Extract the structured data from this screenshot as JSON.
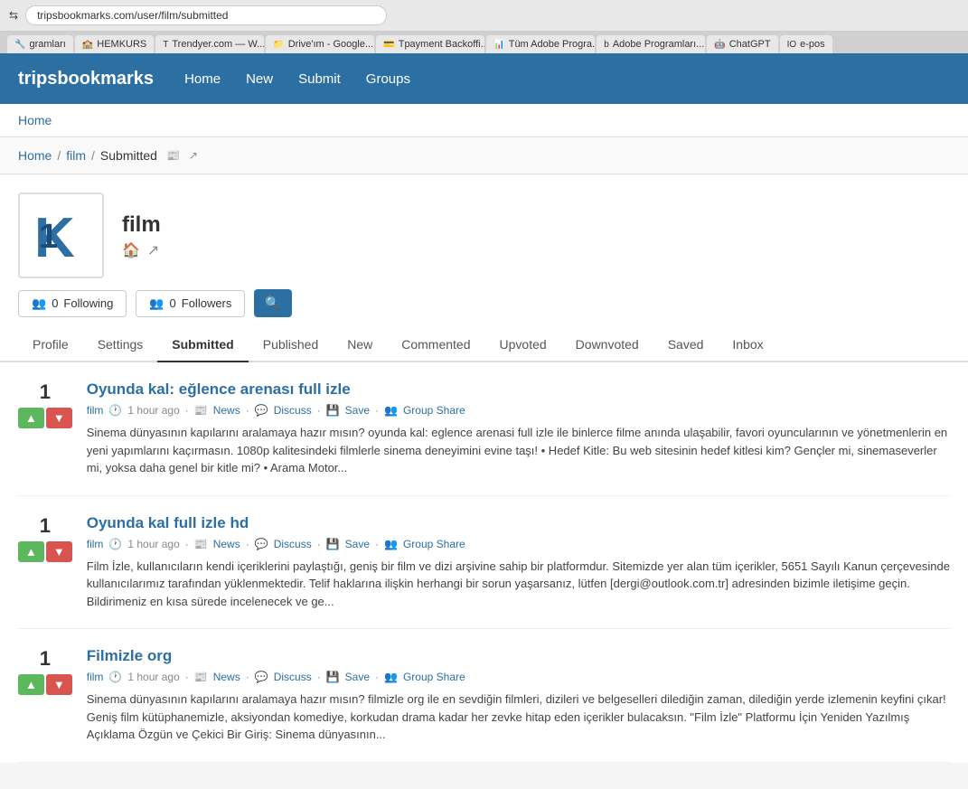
{
  "browser": {
    "url": "tripsbookmarks.com/user/film/submitted",
    "tabs": [
      {
        "label": "gramları",
        "favicon": "🔧",
        "active": false
      },
      {
        "label": "HEMKURS",
        "favicon": "🏫",
        "active": false
      },
      {
        "label": "Trendyer.com — W...",
        "favicon": "T",
        "active": false
      },
      {
        "label": "Drive'ım - Google...",
        "favicon": "📁",
        "active": false
      },
      {
        "label": "Tpayment Backoffi...",
        "favicon": "💳",
        "active": false
      },
      {
        "label": "Tüm Adobe Progra...",
        "favicon": "📊",
        "active": false
      },
      {
        "label": "Adobe Programları...",
        "favicon": "b",
        "active": false
      },
      {
        "label": "ChatGPT",
        "favicon": "🤖",
        "active": false
      },
      {
        "label": "e-pos",
        "favicon": "IO",
        "active": false
      }
    ]
  },
  "nav": {
    "logo": "tripsbookmarks",
    "links": [
      "Home",
      "New",
      "Submit",
      "Groups"
    ]
  },
  "home_bar": {
    "label": "Home"
  },
  "breadcrumb": {
    "home": "Home",
    "section": "film",
    "current": "Submitted"
  },
  "profile": {
    "name": "film",
    "home_icon": "🏠",
    "external_icon": "↗",
    "following_count": "0",
    "following_label": "Following",
    "followers_count": "0",
    "followers_label": "Followers",
    "search_icon": "🔍"
  },
  "tabs": [
    {
      "label": "Profile",
      "active": false
    },
    {
      "label": "Settings",
      "active": false
    },
    {
      "label": "Submitted",
      "active": true
    },
    {
      "label": "Published",
      "active": false
    },
    {
      "label": "New",
      "active": false
    },
    {
      "label": "Commented",
      "active": false
    },
    {
      "label": "Upvoted",
      "active": false
    },
    {
      "label": "Downvoted",
      "active": false
    },
    {
      "label": "Saved",
      "active": false
    },
    {
      "label": "Inbox",
      "active": false
    }
  ],
  "posts": [
    {
      "id": 1,
      "vote_count": "1",
      "title": "Oyunda kal: eğlence arenası full izle",
      "category": "film",
      "time": "1 hour ago",
      "meta_links": [
        "News",
        "Discuss",
        "Save",
        "Group Share"
      ],
      "body": "Sinema dünyasının kapılarını aralamaya hazır mısın? oyunda kal: eglence arenasi full izle ile binlerce filme anında ulaşabilir, favori oyuncularının ve yönetmenlerin en yeni yapımlarını kaçırmasın. 1080p kalitesindeki filmlerle sinema deneyimini evine taşı! • Hedef Kitle: Bu web sitesinin hedef kitlesi kim? Gençler mi, sinemaseverler mi, yoksa daha genel bir kitle mi? • Arama Motor..."
    },
    {
      "id": 2,
      "vote_count": "1",
      "title": "Oyunda kal full izle hd",
      "category": "film",
      "time": "1 hour ago",
      "meta_links": [
        "News",
        "Discuss",
        "Save",
        "Group Share"
      ],
      "body": "Film İzle, kullanıcıların kendi içeriklerini paylaştığı, geniş bir film ve dizi arşivine sahip bir platformdur. Sitemizde yer alan tüm içerikler, 5651 Sayılı Kanun çerçevesinde kullanıcılarımız tarafından yüklenmektedir. Telif haklarına ilişkin herhangi bir sorun yaşarsanız, lütfen [dergi@outlook.com.tr] adresinden bizimle iletişime geçin. Bildirimeniz en kısa sürede incelenecek ve ge..."
    },
    {
      "id": 3,
      "vote_count": "1",
      "title": "Filmizle org",
      "category": "film",
      "time": "1 hour ago",
      "meta_links": [
        "News",
        "Discuss",
        "Save",
        "Group Share"
      ],
      "body": "Sinema dünyasının kapılarını aralamaya hazır mısın? filmizle org ile en sevdiğin filmleri, dizileri ve belgeselleri dilediğin zaman, dilediğin yerde izlemenin keyfini çıkar! Geniş film kütüphanemizle, aksiyondan komediye, korkudan drama kadar her zevke hitap eden içerikler bulacaksın. \"Film İzle\" Platformu İçin Yeniden Yazılmış Açıklama Özgün ve Çekici Bir Giriş: Sinema dünyasının..."
    }
  ]
}
